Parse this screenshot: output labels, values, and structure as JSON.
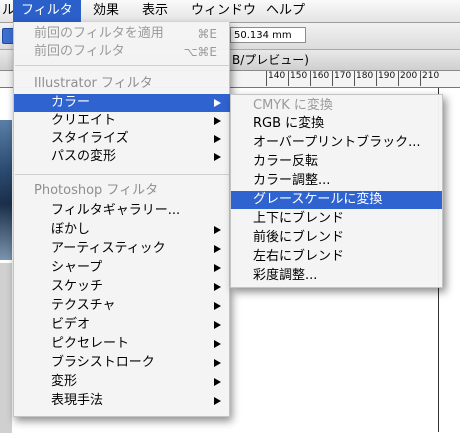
{
  "menubar": {
    "items": [
      {
        "label": "ル"
      },
      {
        "label": "フィルタ"
      },
      {
        "label": "効果"
      },
      {
        "label": "表示"
      },
      {
        "label": "ウィンドウ"
      },
      {
        "label": "ヘルプ"
      }
    ]
  },
  "toolbar": {
    "field_value": "50.134 mm"
  },
  "document": {
    "title_fragment": "B/プレビュー)",
    "ruler_ticks": [
      "140",
      "150",
      "160",
      "170",
      "180",
      "190",
      "200",
      "210"
    ]
  },
  "filter_menu": {
    "apply_last": {
      "label": "前回のフィルタを適用",
      "shortcut": "⌘E"
    },
    "last_filter": {
      "label": "前回のフィルタ",
      "shortcut": "⌥⌘E"
    },
    "illustrator_header": "Illustrator フィルタ",
    "illustrator_items": [
      {
        "label": "カラー"
      },
      {
        "label": "クリエイト"
      },
      {
        "label": "スタイライズ"
      },
      {
        "label": "パスの変形"
      }
    ],
    "photoshop_header": "Photoshop フィルタ",
    "photoshop_items": [
      {
        "label": "フィルタギャラリー..."
      },
      {
        "label": "ぼかし"
      },
      {
        "label": "アーティスティック"
      },
      {
        "label": "シャープ"
      },
      {
        "label": "スケッチ"
      },
      {
        "label": "テクスチャ"
      },
      {
        "label": "ビデオ"
      },
      {
        "label": "ピクセレート"
      },
      {
        "label": "ブラシストローク"
      },
      {
        "label": "変形"
      },
      {
        "label": "表現手法"
      }
    ]
  },
  "color_submenu": {
    "items": [
      {
        "label": "CMYK に変換"
      },
      {
        "label": "RGB に変換"
      },
      {
        "label": "オーバープリントブラック..."
      },
      {
        "label": "カラー反転"
      },
      {
        "label": "カラー調整..."
      },
      {
        "label": "グレースケールに変換"
      },
      {
        "label": "上下にブレンド"
      },
      {
        "label": "前後にブレンド"
      },
      {
        "label": "左右にブレンド"
      },
      {
        "label": "彩度調整..."
      }
    ]
  },
  "colors": {
    "highlight": "#2f63d0",
    "disabled_text": "#9a9a9a"
  }
}
